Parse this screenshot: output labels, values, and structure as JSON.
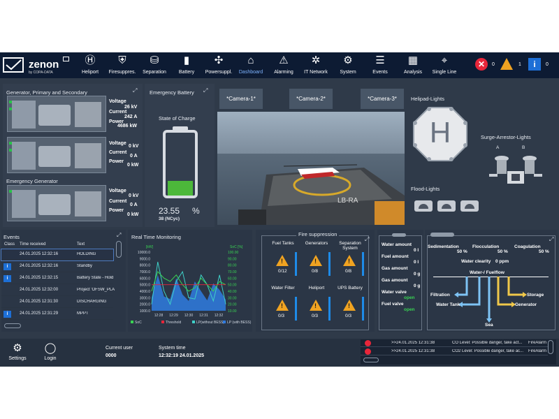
{
  "app": {
    "logo_text": "zenon",
    "logo_sub": "by COPA-DATA"
  },
  "nav": [
    {
      "label": "Heliport",
      "icon": "heliport-icon",
      "glyph": "Ⓗ"
    },
    {
      "label": "Firesuppres.",
      "icon": "fire-icon",
      "glyph": "⛨"
    },
    {
      "label": "Separation",
      "icon": "separation-icon",
      "glyph": "⛁"
    },
    {
      "label": "Battery",
      "icon": "battery-icon",
      "glyph": "▮"
    },
    {
      "label": "Powersuppl.",
      "icon": "fan-icon",
      "glyph": "✣"
    },
    {
      "label": "Dashboard",
      "icon": "home-icon",
      "glyph": "⌂"
    },
    {
      "label": "Alarming",
      "icon": "siren-icon",
      "glyph": "⚠"
    },
    {
      "label": "IT Network",
      "icon": "network-icon",
      "glyph": "✲"
    },
    {
      "label": "System",
      "icon": "gear-icon",
      "glyph": "⚙"
    },
    {
      "label": "Events",
      "icon": "events-icon",
      "glyph": "☰"
    },
    {
      "label": "Analysis",
      "icon": "analysis-icon",
      "glyph": "▦"
    },
    {
      "label": "Single Line",
      "icon": "single-line-icon",
      "glyph": "⌖"
    }
  ],
  "badges": {
    "error_count": "0",
    "warning_count": "1",
    "info_count": "0",
    "error_color": "#e8263a",
    "warning_color": "#f0a321",
    "info_color": "#1d6fd6"
  },
  "generator": {
    "title": "Generator, Primary and Secondary",
    "units": [
      {
        "voltage": "26 kV",
        "current": "242 A",
        "power": "4686 kW"
      },
      {
        "voltage": "0 kV",
        "current": "0 A",
        "power": "0 kW"
      }
    ],
    "emergency_title": "Emergency Generator",
    "emergency": {
      "voltage": "0 kV",
      "current": "0 A",
      "power": "0 kW"
    },
    "labels": {
      "voltage": "Voltage",
      "current": "Current",
      "power": "Power"
    }
  },
  "battery": {
    "title": "Emergency Battery",
    "soc_label": "State of Charge",
    "soc_value": "23.55",
    "soc_unit": "%",
    "soc_fraction": 0.2355,
    "cycles": "38 (NCyc)",
    "fill_color": "#4cb83a"
  },
  "cameras": [
    "*Camera-1*",
    "*Camera-2*",
    "*Camera-3*"
  ],
  "camera_view": {
    "pad_marking": "LB-RA"
  },
  "lights": {
    "helipad": "Helipad-Lights",
    "helipad_letter": "H",
    "surge": "Surge-Arrestor-Lights",
    "surge_a": "A",
    "surge_b": "B",
    "flood": "Flood-Lights"
  },
  "events": {
    "title": "Events",
    "headers": [
      "Class",
      "Time received",
      "Text"
    ],
    "rows": [
      {
        "time": "24.01.2025 12:32:16",
        "text": "HOLDING",
        "info": false
      },
      {
        "time": "24.01.2025 12:32:16",
        "text": "Standby",
        "info": true
      },
      {
        "time": "24.01.2025 12:32:15",
        "text": "Battery State - Hold",
        "info": true
      },
      {
        "time": "24.01.2025 12:32:00",
        "text": "Project 'OFSW_PLA",
        "info": false
      },
      {
        "time": "24.01.2025 12:31:30",
        "text": "DISCHARGING",
        "info": false
      },
      {
        "time": "24.01.2025 12:31:29",
        "text": "MPPT",
        "info": true
      }
    ]
  },
  "realtime": {
    "title": "Real Time Monitoring",
    "left_unit": "[kW]",
    "right_unit": "SoC [%]",
    "left_ticks": [
      "10000.0",
      "9000.0",
      "8000.0",
      "7000.0",
      "6000.0",
      "5000.0",
      "4000.0",
      "3000.0",
      "2000.0",
      "1000.0"
    ],
    "right_ticks": [
      "100.00",
      "90.00",
      "80.00",
      "70.00",
      "60.00",
      "50.00",
      "40.00",
      "30.00",
      "20.00",
      "10.00"
    ],
    "x_ticks": [
      "12:28",
      "12:29",
      "12:30",
      "12:31",
      "12:32"
    ],
    "legend": [
      {
        "name": "SoC",
        "color": "#39d353"
      },
      {
        "name": "Threshold",
        "color": "#e8263a"
      },
      {
        "name": "LP(without BESS)",
        "color": "#3fd0c8"
      },
      {
        "name": "LP (with BESS)",
        "color": "#2f7be0"
      }
    ]
  },
  "chart_data": {
    "type": "area",
    "x": [
      "12:28",
      "12:29",
      "12:30",
      "12:31",
      "12:32"
    ],
    "ylim": [
      1000,
      10000
    ],
    "y2lim": [
      10,
      100
    ],
    "series": [
      {
        "name": "LP (with BESS)",
        "values": [
          3000,
          6500,
          3200,
          2800,
          6000,
          3500,
          2500,
          5500,
          4000,
          2600,
          5200,
          4200,
          2700
        ]
      },
      {
        "name": "LP(without BESS)",
        "values": [
          2000,
          8500,
          4000,
          2000,
          5500,
          7000,
          3000,
          2800,
          6500,
          5000,
          2500,
          6500,
          2000
        ]
      },
      {
        "name": "SoC",
        "values": [
          40,
          70,
          60,
          55,
          65,
          50,
          40,
          45,
          60,
          50,
          40,
          55,
          50
        ]
      },
      {
        "name": "Threshold",
        "values": [
          5000,
          5000,
          5000,
          5000,
          5000,
          5000,
          5000,
          5000,
          5000,
          5000,
          5000,
          5000,
          5000
        ]
      }
    ]
  },
  "fire": {
    "title": "Fire suppression",
    "items": [
      {
        "label": "Fuel Tanks",
        "value": "0/12"
      },
      {
        "label": "Generators",
        "value": "0/8"
      },
      {
        "label": "Separation System",
        "value": "0/8"
      },
      {
        "label": "Water Filter",
        "value": "0/3"
      },
      {
        "label": "Heliport",
        "value": "0/3"
      },
      {
        "label": "UPS Battery",
        "value": "0/3"
      }
    ]
  },
  "fuel": {
    "rows": [
      {
        "label": "Water amount",
        "value": "0 l"
      },
      {
        "label": "Fuel amount",
        "value": "0 l"
      },
      {
        "label": "Gas amount",
        "value": "0 g"
      },
      {
        "label": "Gas amount",
        "value": "0 g"
      },
      {
        "label": "Water valve",
        "value": "open"
      },
      {
        "label": "Fuel valve",
        "value": "open"
      }
    ]
  },
  "water": {
    "sedimentation": "Sedimentation",
    "sed_val": "50 %",
    "flocculation": "Flocculation",
    "floc_val": "50 %",
    "coagulation": "Coagulation",
    "coag_val": "50 %",
    "clearity_label": "Water clearity",
    "clearity_val": "0 ppm",
    "flow_title": "Water-/ Fuelflow",
    "filtration": "Filtration",
    "water_tank": "Water Tank",
    "sea": "Sea",
    "storage": "Storage",
    "generator": "Generator"
  },
  "bottom": {
    "settings": "Settings",
    "login": "Login",
    "user_label": "Current user",
    "user_value": "0000",
    "time_label": "System time",
    "time_value": "12:32:19 24.01.2025"
  },
  "alarms": [
    {
      "time": ">>24.01.2025 12:31:38",
      "text": "CO Level: Possible danger, take act...",
      "class": "FireAlarm"
    },
    {
      "time": ">>24.01.2025 12:31:38",
      "text": "CO2 Level: Possible danger, take ac...",
      "class": "FireAlarm"
    }
  ]
}
